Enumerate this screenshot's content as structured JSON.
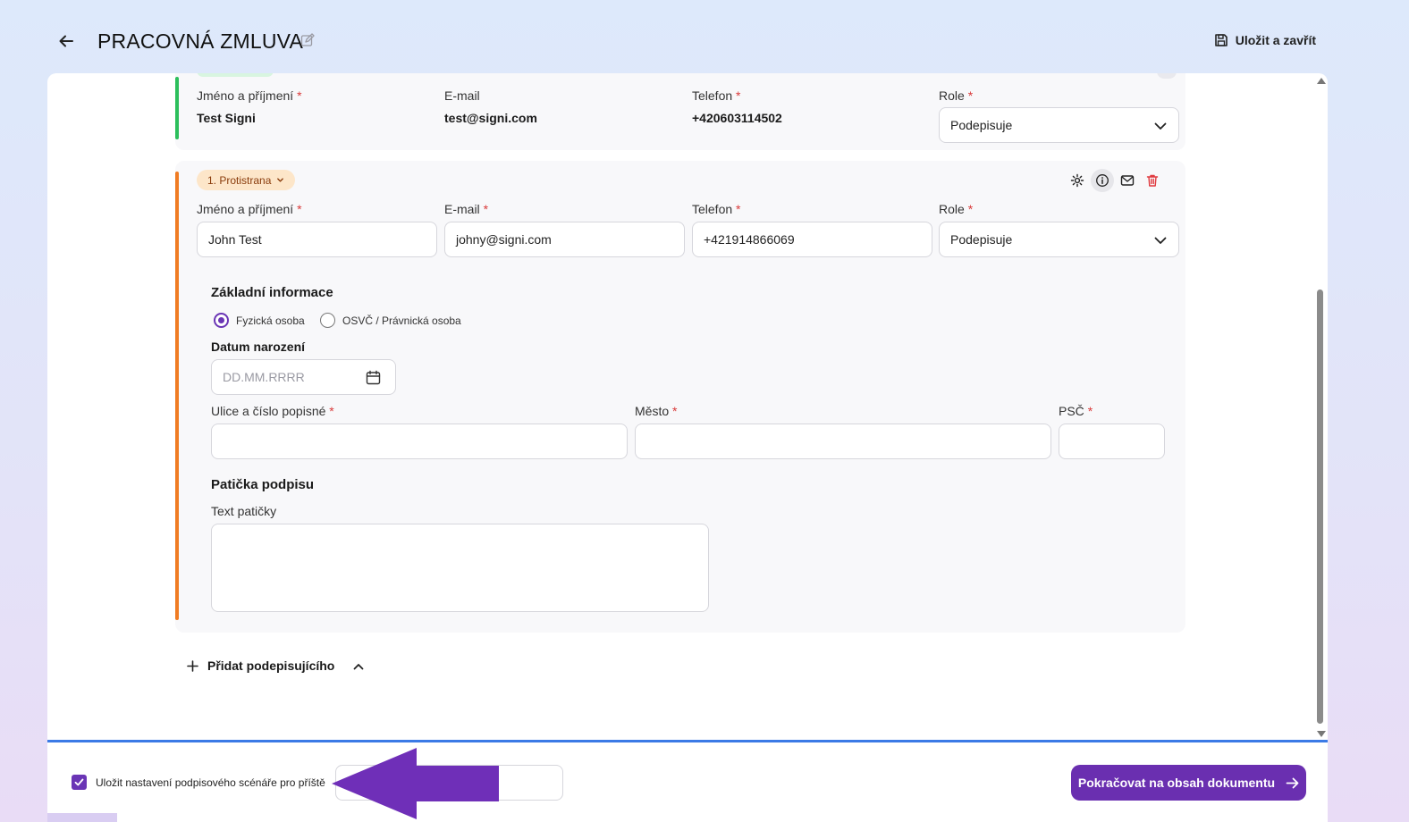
{
  "header": {
    "title": "PRACOVNÁ ZMLUVA",
    "save_close_label": "Uložit a zavřít"
  },
  "signer1": {
    "name_label": "Jméno a příjmení",
    "name_value": "Test Signi",
    "email_label": "E-mail",
    "email_value": "test@signi.com",
    "phone_label": "Telefon",
    "phone_value": "+420603114502",
    "role_label": "Role",
    "role_value": "Podepisuje"
  },
  "signer2": {
    "badge_label": "1. Protistrana",
    "name_label": "Jméno a příjmení",
    "name_value": "John Test",
    "email_label": "E-mail",
    "email_value": "johny@signi.com",
    "phone_label": "Telefon",
    "phone_value": "+421914866069",
    "role_label": "Role",
    "role_value": "Podepisuje",
    "basic_info_title": "Základní informace",
    "radio_person": "Fyzická osoba",
    "radio_company": "OSVČ / Právnická osoba",
    "birthdate_label": "Datum narození",
    "birthdate_placeholder": "DD.MM.RRRR",
    "street_label": "Ulice a číslo popisné",
    "city_label": "Město",
    "zip_label": "PSČ",
    "footer_title": "Patička podpisu",
    "footer_text_label": "Text patičky"
  },
  "add_signer_label": "Přidat podepisujícího",
  "footer": {
    "save_scenario_label": "Uložit nastavení podpisového scénáře pro příště",
    "save_scenario_checked": true,
    "continue_label": "Pokračovat na obsah dokumentu"
  },
  "colors": {
    "accent": "#6a2fb0",
    "signer1_stripe": "#2cbf5c",
    "signer2_stripe": "#f07c23",
    "divider": "#3b7ae6",
    "required": "#d93a3a",
    "annotation_arrow": "#6f2fb8"
  },
  "req_mark": "*"
}
